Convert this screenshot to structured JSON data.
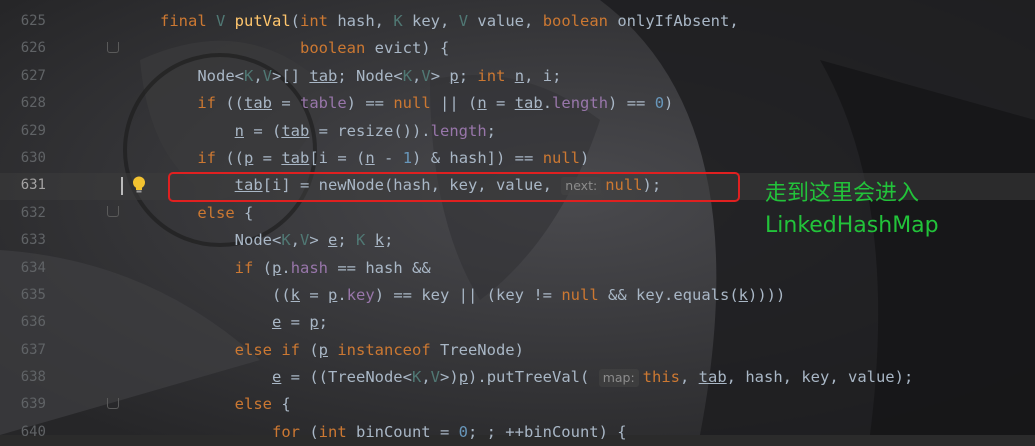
{
  "editor": {
    "lines": [
      {
        "number": "625",
        "tokens": [
          [
            "kw",
            "final "
          ],
          [
            "tp",
            "V "
          ],
          [
            "fn",
            "putVal"
          ],
          [
            "p",
            "("
          ],
          [
            "kw",
            "int "
          ],
          [
            "p",
            "hash, "
          ],
          [
            "tp",
            "K "
          ],
          [
            "p",
            "key, "
          ],
          [
            "tp",
            "V "
          ],
          [
            "p",
            "value, "
          ],
          [
            "kw",
            "boolean "
          ],
          [
            "p",
            "onlyIfAbsent,"
          ]
        ]
      },
      {
        "number": "626",
        "indent": "               ",
        "tokens": [
          [
            "kw",
            "boolean "
          ],
          [
            "p",
            "evict) {"
          ]
        ]
      },
      {
        "number": "627",
        "indent": "    ",
        "tokens": [
          [
            "p",
            "Node<"
          ],
          [
            "tp",
            "K"
          ],
          [
            "p",
            ","
          ],
          [
            "tp",
            "V"
          ],
          [
            "p",
            ">[] "
          ],
          [
            "u",
            "tab"
          ],
          [
            "p",
            "; Node<"
          ],
          [
            "tp",
            "K"
          ],
          [
            "p",
            ","
          ],
          [
            "tp",
            "V"
          ],
          [
            "p",
            "> "
          ],
          [
            "u",
            "p"
          ],
          [
            "p",
            "; "
          ],
          [
            "kw",
            "int "
          ],
          [
            "u",
            "n"
          ],
          [
            "p",
            ", i;"
          ]
        ]
      },
      {
        "number": "628",
        "indent": "    ",
        "tokens": [
          [
            "kw",
            "if "
          ],
          [
            "p",
            "(("
          ],
          [
            "u",
            "tab"
          ],
          [
            "p",
            " = "
          ],
          [
            "fld",
            "table"
          ],
          [
            "p",
            ") == "
          ],
          [
            "kw",
            "null "
          ],
          [
            "p",
            "|| ("
          ],
          [
            "u",
            "n"
          ],
          [
            "p",
            " = "
          ],
          [
            "u",
            "tab"
          ],
          [
            "p",
            "."
          ],
          [
            "fld",
            "length"
          ],
          [
            "p",
            ") == "
          ],
          [
            "num",
            "0"
          ],
          [
            "p",
            ")"
          ]
        ]
      },
      {
        "number": "629",
        "indent": "        ",
        "tokens": [
          [
            "u",
            "n"
          ],
          [
            "p",
            " = ("
          ],
          [
            "u",
            "tab"
          ],
          [
            "p",
            " = resize())."
          ],
          [
            "fld",
            "length"
          ],
          [
            "p",
            ";"
          ]
        ]
      },
      {
        "number": "630",
        "indent": "    ",
        "tokens": [
          [
            "kw",
            "if "
          ],
          [
            "p",
            "(("
          ],
          [
            "u",
            "p"
          ],
          [
            "p",
            " = "
          ],
          [
            "u",
            "tab"
          ],
          [
            "p",
            "[i = ("
          ],
          [
            "u",
            "n"
          ],
          [
            "p",
            " - "
          ],
          [
            "num",
            "1"
          ],
          [
            "p",
            ") & hash]) == "
          ],
          [
            "kw",
            "null"
          ],
          [
            "p",
            ")"
          ]
        ]
      },
      {
        "number": "631",
        "current": true,
        "indent": "        ",
        "tokens": [
          [
            "u",
            "tab"
          ],
          [
            "p",
            "[i] = newNode(hash, key, value, "
          ],
          [
            "hint",
            "next:"
          ],
          [
            "kw",
            "null"
          ],
          [
            "p",
            ");"
          ]
        ]
      },
      {
        "number": "632",
        "indent": "    ",
        "tokens": [
          [
            "kw",
            "else "
          ],
          [
            "p",
            "{"
          ]
        ]
      },
      {
        "number": "633",
        "indent": "        ",
        "tokens": [
          [
            "p",
            "Node<"
          ],
          [
            "tp",
            "K"
          ],
          [
            "p",
            ","
          ],
          [
            "tp",
            "V"
          ],
          [
            "p",
            "> "
          ],
          [
            "u",
            "e"
          ],
          [
            "p",
            "; "
          ],
          [
            "tp",
            "K "
          ],
          [
            "u",
            "k"
          ],
          [
            "p",
            ";"
          ]
        ]
      },
      {
        "number": "634",
        "indent": "        ",
        "tokens": [
          [
            "kw",
            "if "
          ],
          [
            "p",
            "("
          ],
          [
            "u",
            "p"
          ],
          [
            "p",
            "."
          ],
          [
            "fld",
            "hash"
          ],
          [
            "p",
            " == hash &&"
          ]
        ]
      },
      {
        "number": "635",
        "indent": "            ",
        "tokens": [
          [
            "p",
            "(("
          ],
          [
            "u",
            "k"
          ],
          [
            "p",
            " = "
          ],
          [
            "u",
            "p"
          ],
          [
            "p",
            "."
          ],
          [
            "fld",
            "key"
          ],
          [
            "p",
            ") == key || (key != "
          ],
          [
            "kw",
            "null "
          ],
          [
            "p",
            "&& key.equals("
          ],
          [
            "u",
            "k"
          ],
          [
            "p",
            "))))"
          ]
        ]
      },
      {
        "number": "636",
        "indent": "            ",
        "tokens": [
          [
            "u",
            "e"
          ],
          [
            "p",
            " = "
          ],
          [
            "u",
            "p"
          ],
          [
            "p",
            ";"
          ]
        ]
      },
      {
        "number": "637",
        "indent": "        ",
        "tokens": [
          [
            "kw",
            "else if "
          ],
          [
            "p",
            "("
          ],
          [
            "u",
            "p"
          ],
          [
            "kw",
            " instanceof "
          ],
          [
            "p",
            "TreeNode)"
          ]
        ]
      },
      {
        "number": "638",
        "indent": "            ",
        "tokens": [
          [
            "u",
            "e"
          ],
          [
            "p",
            " = ((TreeNode<"
          ],
          [
            "tp",
            "K"
          ],
          [
            "p",
            ","
          ],
          [
            "tp",
            "V"
          ],
          [
            "p",
            ">)"
          ],
          [
            "u",
            "p"
          ],
          [
            "p",
            ").putTreeVal( "
          ],
          [
            "hint",
            "map:"
          ],
          [
            "kw",
            "this"
          ],
          [
            "p",
            ", "
          ],
          [
            "u",
            "tab"
          ],
          [
            "p",
            ", hash, key, value);"
          ]
        ]
      },
      {
        "number": "639",
        "indent": "        ",
        "tokens": [
          [
            "kw",
            "else "
          ],
          [
            "p",
            "{"
          ]
        ]
      },
      {
        "number": "640",
        "indent": "            ",
        "tokens": [
          [
            "kw",
            "for "
          ],
          [
            "p",
            "("
          ],
          [
            "kw",
            "int "
          ],
          [
            "p",
            "binCount = "
          ],
          [
            "num",
            "0"
          ],
          [
            "p",
            "; ; ++binCount) {"
          ]
        ]
      }
    ]
  },
  "annotation": {
    "line1": "走到这里会进入",
    "line2": "LinkedHashMap"
  },
  "colors": {
    "keyword": "#cc7832",
    "annotation": "#22c33a",
    "highlight_box": "#e02020"
  }
}
